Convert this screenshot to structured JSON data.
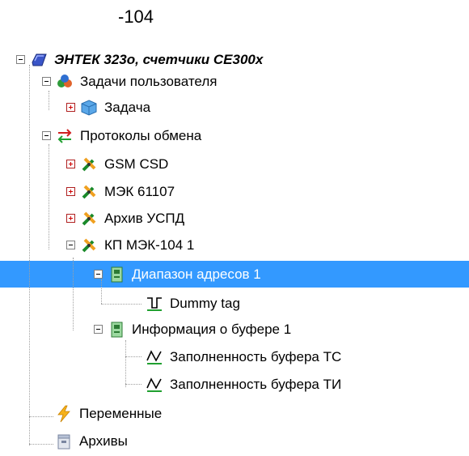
{
  "caption": "-104",
  "tree": {
    "root": {
      "label": "ЭНТЕК 323о, счетчики CE300x",
      "icon": "device-icon"
    },
    "tasks_group": {
      "label": "Задачи пользователя",
      "icon": "tasks-icon"
    },
    "task": {
      "label": "Задача",
      "icon": "cube-icon"
    },
    "protocols_group": {
      "label": "Протоколы обмена",
      "icon": "exchange-arrows-icon"
    },
    "gsm": {
      "label": "GSM CSD",
      "icon": "protocol-plug-icon"
    },
    "iec61107": {
      "label": "МЭК 61107",
      "icon": "protocol-plug-icon"
    },
    "archive_uspd": {
      "label": "Архив УСПД",
      "icon": "protocol-plug-icon"
    },
    "kp_iec104": {
      "label": "КП МЭК-104 1",
      "icon": "protocol-plug-icon"
    },
    "address_range": {
      "label": "Диапазон адресов 1",
      "icon": "module-icon",
      "selected": true
    },
    "dummy_tag": {
      "label": "Dummy tag",
      "icon": "digital-signal-icon"
    },
    "buffer_info": {
      "label": "Информация о буфере 1",
      "icon": "module-icon"
    },
    "buffer_tc": {
      "label": "Заполненность буфера ТС",
      "icon": "analog-signal-icon"
    },
    "buffer_ti": {
      "label": "Заполненность буфера ТИ",
      "icon": "analog-signal-icon"
    },
    "variables": {
      "label": "Переменные",
      "icon": "lightning-icon"
    },
    "archives": {
      "label": "Архивы",
      "icon": "archive-icon"
    }
  },
  "colors": {
    "selection": "#3399ff",
    "expander_plus": "#d00000"
  }
}
